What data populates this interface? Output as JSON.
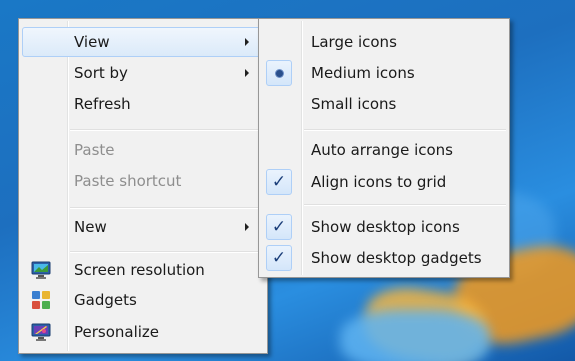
{
  "context_menu": {
    "items": [
      {
        "label": "View",
        "has_submenu": true,
        "highlighted": true
      },
      {
        "label": "Sort by",
        "has_submenu": true
      },
      {
        "label": "Refresh"
      },
      {
        "label": "Paste",
        "disabled": true
      },
      {
        "label": "Paste shortcut",
        "disabled": true
      },
      {
        "label": "New",
        "has_submenu": true
      },
      {
        "label": "Screen resolution",
        "icon": "screen-resolution-icon"
      },
      {
        "label": "Gadgets",
        "icon": "gadgets-icon"
      },
      {
        "label": "Personalize",
        "icon": "personalize-icon"
      }
    ]
  },
  "view_submenu": {
    "items": [
      {
        "label": "Large icons"
      },
      {
        "label": "Medium icons",
        "selected": true,
        "mark": "radio"
      },
      {
        "label": "Small icons"
      },
      {
        "label": "Auto arrange icons"
      },
      {
        "label": "Align icons to grid",
        "checked": true
      },
      {
        "label": "Show desktop icons",
        "checked": true
      },
      {
        "label": "Show desktop gadgets",
        "checked": true
      }
    ],
    "check_glyph": "✓"
  },
  "colors": {
    "menu_background": "#f1f1f1",
    "highlight": "#dbeaf9",
    "disabled_text": "#8e8e8e"
  }
}
